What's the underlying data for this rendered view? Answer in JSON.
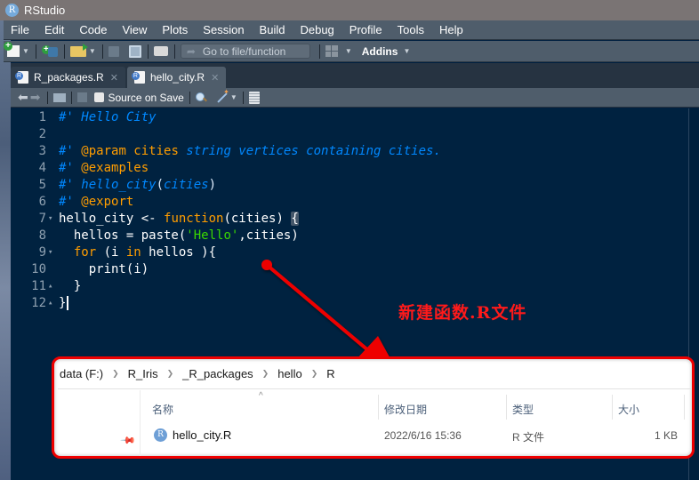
{
  "window": {
    "title": "RStudio",
    "app_icon": "R"
  },
  "menu": [
    "File",
    "Edit",
    "Code",
    "View",
    "Plots",
    "Session",
    "Build",
    "Debug",
    "Profile",
    "Tools",
    "Help"
  ],
  "toolbar": {
    "goto_placeholder": "Go to file/function",
    "addins_label": "Addins"
  },
  "tabs": [
    {
      "label": "R_packages.R",
      "active": false
    },
    {
      "label": "hello_city.R",
      "active": true
    }
  ],
  "editor_toolbar": {
    "source_on_save_label": "Source on Save",
    "source_on_save_checked": false
  },
  "code_lines": [
    {
      "n": "1",
      "fold": "",
      "tokens": [
        {
          "t": "#' Hello City",
          "c": "c-com"
        }
      ]
    },
    {
      "n": "2",
      "fold": "",
      "tokens": []
    },
    {
      "n": "3",
      "fold": "",
      "tokens": [
        {
          "t": "#' ",
          "c": "c-com"
        },
        {
          "t": "@param cities",
          "c": "c-tag"
        },
        {
          "t": " string vertices containing cities.",
          "c": "c-com"
        }
      ]
    },
    {
      "n": "4",
      "fold": "",
      "tokens": [
        {
          "t": "#' ",
          "c": "c-com"
        },
        {
          "t": "@examples",
          "c": "c-tag"
        }
      ]
    },
    {
      "n": "5",
      "fold": "",
      "tokens": [
        {
          "t": "#' hello_city",
          "c": "c-com"
        },
        {
          "t": "(",
          "c": "c-paren"
        },
        {
          "t": "cities",
          "c": "c-com"
        },
        {
          "t": ")",
          "c": "c-paren"
        }
      ]
    },
    {
      "n": "6",
      "fold": "",
      "tokens": [
        {
          "t": "#' ",
          "c": "c-com"
        },
        {
          "t": "@export",
          "c": "c-tag"
        }
      ]
    },
    {
      "n": "7",
      "fold": "▾",
      "tokens": [
        {
          "t": "hello_city <- ",
          "c": "c-plain"
        },
        {
          "t": "function",
          "c": "c-kw"
        },
        {
          "t": "(cities) ",
          "c": "c-plain"
        },
        {
          "t": "{",
          "c": "c-plain bracket-hl"
        }
      ]
    },
    {
      "n": "8",
      "fold": "",
      "tokens": [
        {
          "t": "  hellos = paste(",
          "c": "c-plain"
        },
        {
          "t": "'Hello'",
          "c": "c-str"
        },
        {
          "t": ",cities)",
          "c": "c-plain"
        }
      ]
    },
    {
      "n": "9",
      "fold": "▾",
      "tokens": [
        {
          "t": "  ",
          "c": "c-plain"
        },
        {
          "t": "for",
          "c": "c-kw"
        },
        {
          "t": " (i ",
          "c": "c-plain"
        },
        {
          "t": "in",
          "c": "c-kw"
        },
        {
          "t": " hellos ){",
          "c": "c-plain"
        }
      ]
    },
    {
      "n": "10",
      "fold": "",
      "tokens": [
        {
          "t": "    print(i)",
          "c": "c-plain"
        }
      ]
    },
    {
      "n": "11",
      "fold": "▴",
      "tokens": [
        {
          "t": "  }",
          "c": "c-plain"
        }
      ]
    },
    {
      "n": "12",
      "fold": "▴",
      "tokens": [
        {
          "t": "}",
          "c": "c-plain"
        }
      ]
    }
  ],
  "annotation": {
    "text": "新建函数.R文件",
    "color": "#ff1a1a"
  },
  "explorer": {
    "breadcrumb": [
      "data (F:)",
      "R_Iris",
      "_R_packages",
      "hello",
      "R"
    ],
    "columns": {
      "name": "名称",
      "modified": "修改日期",
      "type": "类型",
      "size": "大小"
    },
    "files": [
      {
        "name": "hello_city.R",
        "modified": "2022/6/16 15:36",
        "type": "R 文件",
        "size": "1 KB"
      }
    ]
  },
  "colors": {
    "editor_bg": "#002240",
    "comment": "#0088ff",
    "keyword": "#ff9d00",
    "string": "#3ad900",
    "highlight_border": "#ee0000"
  }
}
